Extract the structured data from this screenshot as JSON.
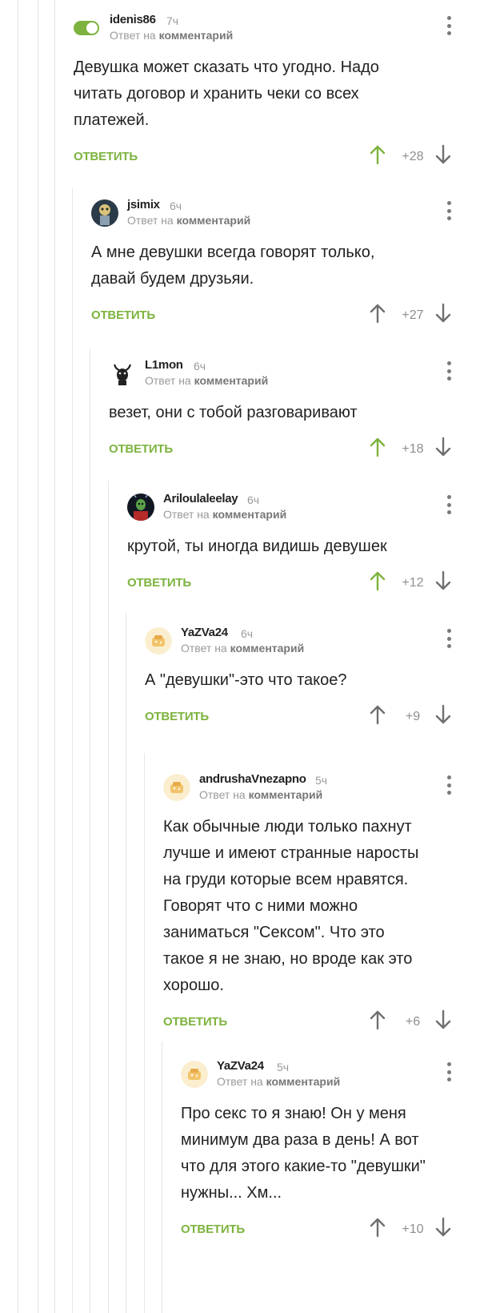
{
  "reply_prefix": "Ответ на",
  "reply_target": "комментарий",
  "reply_button": "ОТВЕТИТЬ",
  "colors": {
    "accent": "#7db33e",
    "up_active": "#7db33e",
    "up_inactive": "#6f6f6f",
    "down": "#6f6f6f"
  },
  "comments": [
    {
      "username": "idenis86",
      "time": "7ч",
      "avatar_icon": "toggle-icon",
      "lines": [
        "Девушка может сказать что угодно. Надо",
        "читать договор и хранить чеки со всех",
        "платежей."
      ],
      "score": "+28",
      "upvoted": true
    },
    {
      "username": "jsimix",
      "time": "6ч",
      "avatar_icon": "robot-avatar-icon",
      "lines": [
        "А мне девушки всегда говорят только,",
        "давай будем друзьяи."
      ],
      "score": "+27",
      "upvoted": false
    },
    {
      "username": "L1mon",
      "time": "6ч",
      "avatar_icon": "horned-creature-icon",
      "lines": [
        "везет, они с тобой разговаривают"
      ],
      "score": "+18",
      "upvoted": true
    },
    {
      "username": "Ariloulaleelay",
      "time": "6ч",
      "avatar_icon": "alien-avatar-icon",
      "lines": [
        "крутой, ты иногда видишь девушек"
      ],
      "score": "+12",
      "upvoted": true
    },
    {
      "username": "YaZVa24",
      "time": "6ч",
      "avatar_icon": "default-avatar-icon",
      "lines": [
        "А \"девушки\"-это что такое?"
      ],
      "score": "+9",
      "upvoted": false
    },
    {
      "username": "andrushaVnezapno",
      "time": "5ч",
      "avatar_icon": "default-avatar-icon",
      "lines": [
        "Как обычные люди только пахнут",
        "лучше и имеют странные наросты",
        "на груди которые всем нравятся.",
        "Говорят что с ними можно",
        "заниматься \"Сексом\". Что это",
        "такое я не знаю, но вроде как это",
        "хорошо."
      ],
      "score": "+6",
      "upvoted": false
    },
    {
      "username": "YaZVa24",
      "time": "5ч",
      "avatar_icon": "default-avatar-icon",
      "lines": [
        "Про секс то я знаю! Он у меня",
        "минимум два раза в день! А вот",
        "что для этого какие-то \"девушки\"",
        "нужны... Хм..."
      ],
      "score": "+10",
      "upvoted": false
    }
  ]
}
